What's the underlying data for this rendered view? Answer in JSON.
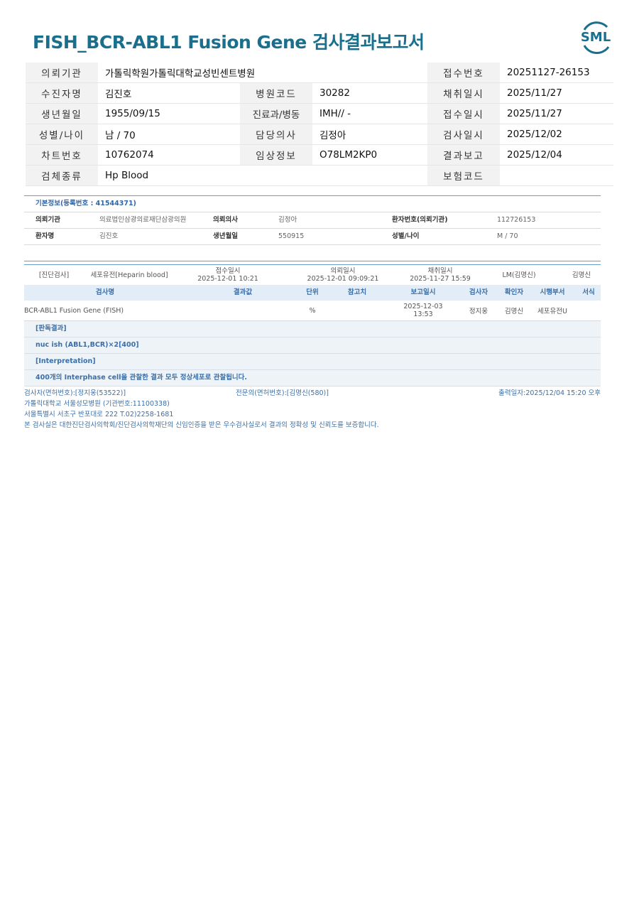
{
  "header": {
    "title": "FISH_BCR-ABL1 Fusion Gene 검사결과보고서",
    "logo_text": "SML",
    "brand_color": "#1a6f8c"
  },
  "patient": {
    "rows": [
      [
        {
          "label": "의뢰기관",
          "value": "가톨릭학원가톨릭대학교성빈센트병원"
        },
        {
          "label": "",
          "value": ""
        },
        {
          "label": "접수번호",
          "value": "20251127-26153"
        }
      ],
      [
        {
          "label": "수진자명",
          "value": "김진호"
        },
        {
          "label": "병원코드",
          "value": "30282"
        },
        {
          "label": "채취일시",
          "value": "2025/11/27"
        }
      ],
      [
        {
          "label": "생년월일",
          "value": "1955/09/15"
        },
        {
          "label": "진료과/병동",
          "value": "IMH// -"
        },
        {
          "label": "접수일시",
          "value": "2025/11/27"
        }
      ],
      [
        {
          "label": "성별/나이",
          "value": "남 / 70"
        },
        {
          "label": "담당의사",
          "value": "김정아"
        },
        {
          "label": "검사일시",
          "value": "2025/12/02"
        }
      ],
      [
        {
          "label": "차트번호",
          "value": "10762074"
        },
        {
          "label": "임상정보",
          "value": "O78LM2KP0"
        },
        {
          "label": "결과보고",
          "value": "2025/12/04"
        }
      ],
      [
        {
          "label": "검체종류",
          "value": "Hp Blood"
        },
        {
          "label": "",
          "value": ""
        },
        {
          "label": "보험코드",
          "value": ""
        }
      ]
    ]
  },
  "basic": {
    "title": "기본정보(등록번호 : 41544371)",
    "row1": {
      "l1": "의뢰기관",
      "v1": "의료법인삼광의료재단삼광의원",
      "l2": "의뢰의사",
      "v2": "김정아",
      "l3": "환자번호(의뢰기관)",
      "v3": "112726153"
    },
    "row2": {
      "l1": "환자명",
      "v1": "김진호",
      "l2": "생년월일",
      "v2": "550915",
      "l3": "성별/나이",
      "v3": "M / 70"
    }
  },
  "exam": {
    "type": "[진단검사]",
    "specimen": "세포유전[Heparin blood]",
    "received_label": "접수일시",
    "received": "2025-12-01 10:21",
    "requested_label": "의뢰일시",
    "requested": "2025-12-01 09:09:21",
    "collected_label": "채취일시",
    "collected": "2025-11-27 15:59",
    "lm": "LM(김명신)",
    "doctor": "김명신"
  },
  "results": {
    "headers": [
      "검사명",
      "결과값",
      "단위",
      "참고치",
      "보고일시",
      "검사자",
      "확인자",
      "시행부서",
      "서식"
    ],
    "rows": [
      {
        "name": "BCR-ABL1 Fusion Gene (FISH)",
        "result": "",
        "unit": "%",
        "ref": "",
        "report_date": "2025-12-03",
        "report_time": "13:53",
        "tester": "정지웅",
        "confirmer": "김명신",
        "dept": "세포유전U",
        "form": ""
      }
    ]
  },
  "interpretation": {
    "judgement_label": "[판독결과]",
    "judgement": "nuc ish (ABL1,BCR)×2[400]",
    "interp_label": "[Interpretation]",
    "interp": "400개의 Interphase cell을 관찰한 결과 모두 정상세포로 관찰됩니다."
  },
  "footer": {
    "tester": "검사자(면허번호):[정지웅(53522)]",
    "specialist": "전문의(면허번호):[김명신(580)]",
    "printed": "출력일자:2025/12/04 15:20 오후",
    "institution": "가톨릭대학교 서울성모병원 (기관번호:11100338)",
    "address": "서울특별시 서초구 반포대로 222 T.02)2258-1681",
    "certification": "본 검사실은 대한진단검사의학회/진단검사의학재단의 신임인증을 받은 우수검사실로서 결과의 정확성 및 신뢰도를 보증합니다."
  }
}
